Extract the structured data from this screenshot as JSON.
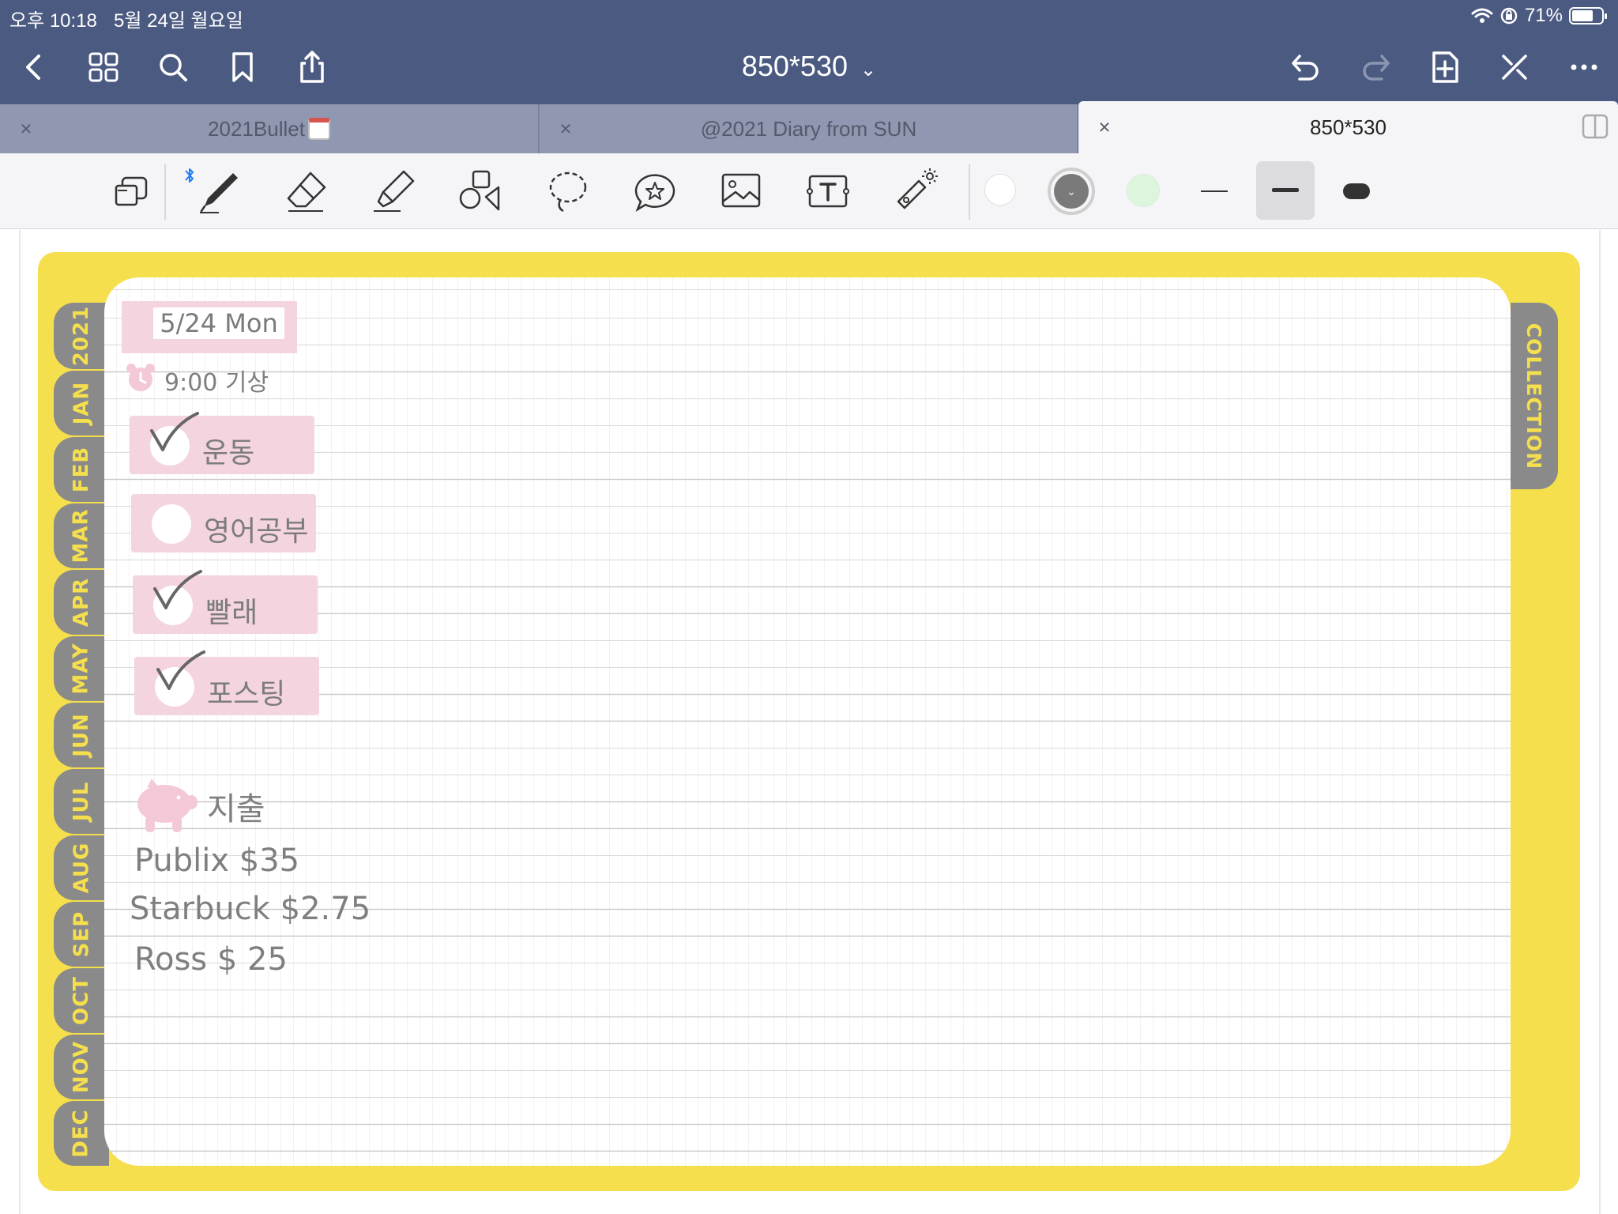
{
  "status_bar": {
    "time": "오후 10:18",
    "date": "5월 24일 월요일",
    "battery": "71%",
    "battery_level": 0.71
  },
  "nav": {
    "title": "850*530"
  },
  "tabs": [
    {
      "label": "2021Bullet"
    },
    {
      "label": "@2021 Diary from SUN"
    },
    {
      "label": "850*530"
    }
  ],
  "tab_close_glyph": "×",
  "tools": [
    "lasso-shape",
    "pen",
    "eraser",
    "highlighter",
    "shapes",
    "lasso",
    "sticker",
    "image",
    "text",
    "laser-pointer"
  ],
  "colors": {
    "swatch_white": "#ffffff",
    "swatch_gray": "#7a7a7a",
    "swatch_green": "#ddf5dd",
    "planner_yellow": "#f5df4d",
    "tab_gray": "#8a8a8a",
    "pink": "#f4d4df",
    "topbar": "#4b5a80"
  },
  "planner": {
    "year": "2021",
    "months": [
      "JAN",
      "FEB",
      "MAR",
      "APR",
      "MAY",
      "JUN",
      "JUL",
      "AUG",
      "SEP",
      "OCT",
      "NOV",
      "DEC"
    ],
    "collection": "COLLECTION"
  },
  "notes": {
    "date": "5/24 Mon",
    "wake": "9:00 기상",
    "tasks": [
      {
        "label": "운동",
        "done": true
      },
      {
        "label": "영어공부",
        "done": false
      },
      {
        "label": "빨래",
        "done": true
      },
      {
        "label": "포스팅",
        "done": true
      }
    ],
    "expense_title": "지출",
    "expenses": [
      "Publix $35",
      "Starbuck $2.75",
      "Ross $ 25"
    ]
  }
}
